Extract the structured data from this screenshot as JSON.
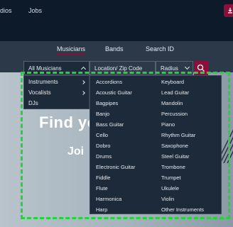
{
  "topnav": {
    "studios": "dios",
    "jobs": "Jobs"
  },
  "tabs": {
    "musicians": "Musicians",
    "bands": "Bands",
    "search_id": "Search ID"
  },
  "search": {
    "category_value": "All Musicians",
    "location_placeholder": "Location/ Zip Code",
    "radius_value": "Radius"
  },
  "hero": {
    "title": "Find yo",
    "subtitle": "Joi"
  },
  "category_menu": [
    {
      "label": "Instruments"
    },
    {
      "label": "Vocalists"
    },
    {
      "label": "DJs"
    }
  ],
  "instruments": [
    "Accordions",
    "Keyboard",
    "Acoustic Guitar",
    "Lead Guitar",
    "Bagpipes",
    "Mandolin",
    "Banjo",
    "Percussion",
    "Bass Guitar",
    "Piano",
    "Cello",
    "Rhythm Guitar",
    "Dobro",
    "Saxophone",
    "Drums",
    "Steel Guitar",
    "Electronic Guitar",
    "Trombone",
    "Fiddle",
    "Trumpet",
    "Flute",
    "Ukulele",
    "Harmonica",
    "Violin",
    "Harp",
    "Other Instruments"
  ],
  "colors": {
    "accent": "#8a0f3a",
    "highlight": "#22d33a",
    "menu_bg": "#1d2a3a"
  }
}
